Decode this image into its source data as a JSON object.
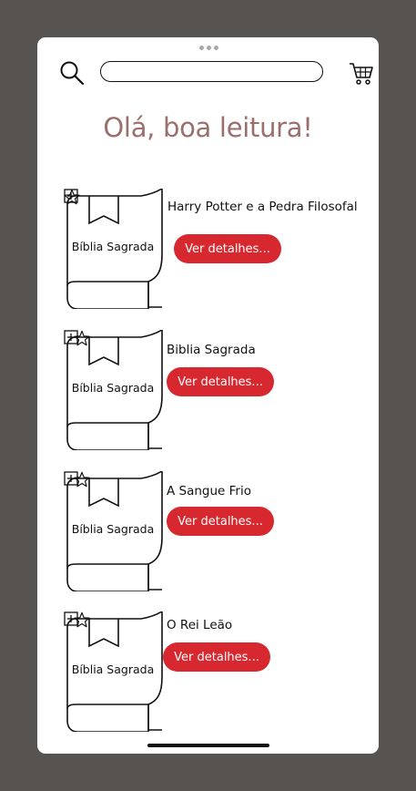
{
  "app": {
    "greeting": "Olá, boa leitura!",
    "search_placeholder": ""
  },
  "books": [
    {
      "cover_label": "Bíblia Sagrada",
      "title": "Harry Potter e a Pedra Filosofal",
      "button_label": "Ver detalhes..."
    },
    {
      "cover_label": "Bíblia Sagrada",
      "title": "Biblia Sagrada",
      "button_label": "Ver detalhes..."
    },
    {
      "cover_label": "Bíblia Sagrada",
      "title": "A Sangue Frio",
      "button_label": "Ver detalhes..."
    },
    {
      "cover_label": "Bíblia Sagrada",
      "title": "O Rei Leão",
      "button_label": "Ver detalhes..."
    }
  ],
  "colors": {
    "background": "#575351",
    "screen": "#ffffff",
    "accent": "#d8282f",
    "greeting": "#9b706c"
  },
  "icons": [
    "search-icon",
    "cart-icon",
    "bookmark-icon",
    "star-icon",
    "plus-icon"
  ]
}
